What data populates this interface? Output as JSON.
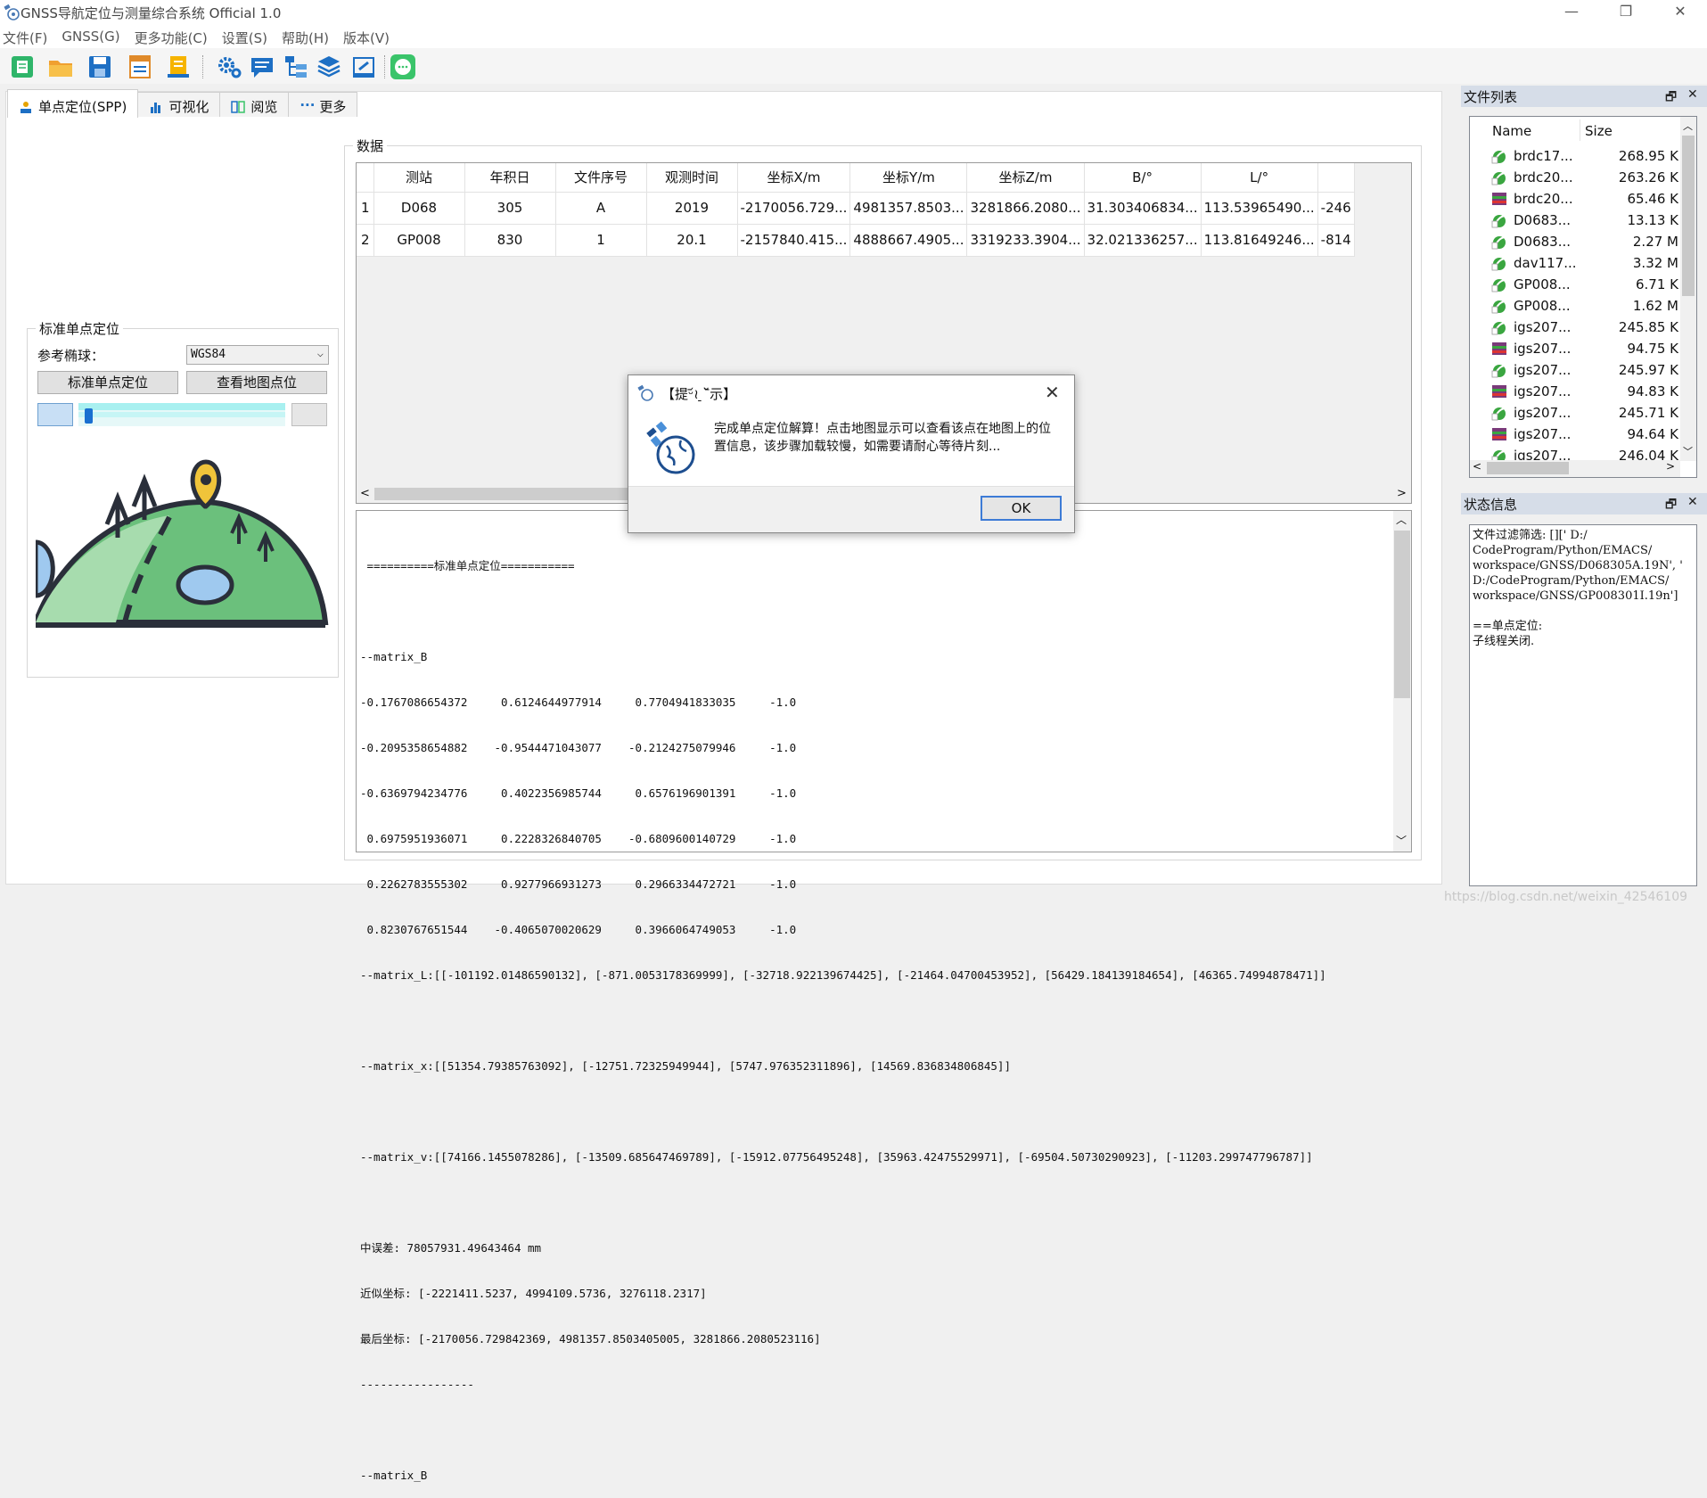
{
  "window": {
    "title": "GNSS导航定位与测量综合系统 Official 1.0",
    "minimize": "—",
    "maximize": "❐",
    "close": "✕"
  },
  "menu": [
    "文件(F)",
    "GNSS(G)",
    "更多功能(C)",
    "设置(S)",
    "帮助(H)",
    "版本(V)"
  ],
  "tabs": [
    {
      "label": "单点定位(SPP)",
      "icon": "person-pin-icon"
    },
    {
      "label": "可视化",
      "icon": "bar-chart-icon"
    },
    {
      "label": "阅览",
      "icon": "grid-view-icon"
    },
    {
      "label": "更多",
      "icon": "more-dots-icon"
    }
  ],
  "spp": {
    "group_title": "标准单点定位",
    "ellipsoid_label": "参考椭球：",
    "ellipsoid_value": "WGS84",
    "btn_position": "标准单点定位",
    "btn_map": "查看地图点位",
    "progress_percent": 2
  },
  "data": {
    "group_title": "数据",
    "columns": [
      "测站",
      "年积日",
      "文件序号",
      "观测时间",
      "坐标X/m",
      "坐标Y/m",
      "坐标Z/m",
      "B/°",
      "L/°",
      ""
    ],
    "rows": [
      [
        "1",
        "D068",
        "305",
        "A",
        "2019",
        "-2170056.729...",
        "4981357.8503...",
        "3281866.2080...",
        "31.303406834...",
        "113.53965490...",
        "-246"
      ],
      [
        "2",
        "GP008",
        "830",
        "1",
        "20.1",
        "-2157840.415...",
        "4888667.4905...",
        "3319233.3904...",
        "32.021336257...",
        "113.81649246...",
        "-814"
      ]
    ]
  },
  "log": {
    "lines": [
      " ==========标准单点定位===========",
      "",
      "--matrix_B",
      "-0.1767086654372     0.6124644977914     0.7704941833035     -1.0",
      "-0.2095358654882    -0.9544471043077    -0.2124275079946     -1.0",
      "-0.6369794234776     0.4022356985744     0.6576196901391     -1.0",
      " 0.6975951936071     0.2228326840705    -0.6809600140729     -1.0",
      " 0.2262783555302     0.9277966931273     0.2966334472721     -1.0",
      " 0.8230767651544    -0.4065070020629     0.3966064749053     -1.0",
      "--matrix_L:[[-101192.01486590132], [-871.0053178369999], [-32718.922139674425], [-21464.04700453952], [56429.184139184654], [46365.74994878471]]",
      "",
      "--matrix_x:[[51354.79385763092], [-12751.72325949944], [5747.976352311896], [14569.836834806845]]",
      "",
      "--matrix_v:[[74166.1455078286], [-13509.685647469789], [-15912.07756495248], [35963.42475529971], [-69504.50730290923], [-11203.299747796787]]",
      "",
      "中误差: 78057931.49643464 mm",
      "近似坐标: [-2221411.5237, 4994109.5736, 3276118.2317]",
      "最后坐标: [-2170056.729842369, 4981357.8503405005, 3281866.2080523116]",
      "-----------------",
      "",
      "--matrix_B"
    ]
  },
  "dialog": {
    "title": "【提ᵕ᷄≀ ̠˘᷅示】",
    "message": "完成单点定位解算！点击地图显示可以查看该点在地图上的位置信息，该步骤加载较慢，如需要请耐心等待片刻...",
    "ok": "OK",
    "close": "✕"
  },
  "file_list": {
    "title": "文件列表",
    "col_name": "Name",
    "col_size": "Size",
    "items": [
      {
        "name": "brdc17...",
        "size": "268.95 K",
        "icon": "green-file-icon"
      },
      {
        "name": "brdc20...",
        "size": "263.26 K",
        "icon": "green-file-icon"
      },
      {
        "name": "brdc20...",
        "size": "65.46 K",
        "icon": "archive-file-icon"
      },
      {
        "name": "D0683...",
        "size": "13.13 K",
        "icon": "green-file-icon"
      },
      {
        "name": "D0683...",
        "size": "2.27 M",
        "icon": "green-file-icon"
      },
      {
        "name": "dav117...",
        "size": "3.32 M",
        "icon": "green-file-icon"
      },
      {
        "name": "GP008...",
        "size": "6.71 K",
        "icon": "green-file-icon"
      },
      {
        "name": "GP008...",
        "size": "1.62 M",
        "icon": "green-file-icon"
      },
      {
        "name": "igs207...",
        "size": "245.85 K",
        "icon": "green-file-icon"
      },
      {
        "name": "igs207...",
        "size": "94.75 K",
        "icon": "archive-file-icon"
      },
      {
        "name": "igs207...",
        "size": "245.97 K",
        "icon": "green-file-icon"
      },
      {
        "name": "igs207...",
        "size": "94.83 K",
        "icon": "archive-file-icon"
      },
      {
        "name": "igs207...",
        "size": "245.71 K",
        "icon": "green-file-icon"
      },
      {
        "name": "igs207...",
        "size": "94.64 K",
        "icon": "archive-file-icon"
      },
      {
        "name": "igs207...",
        "size": "246.04 K",
        "icon": "green-file-icon"
      }
    ]
  },
  "status": {
    "title": "状态信息",
    "text": "文件过滤筛选: [][' D:/ CodeProgram/Python/EMACS/ workspace/GNSS/D068305A.19N', ' D:/CodeProgram/Python/EMACS/ workspace/GNSS/GP008301I.19n']\n\n==单点定位:\n子线程关闭."
  },
  "panel_buttons": {
    "float": "🗗",
    "close": "✕"
  },
  "watermark": "https://blog.csdn.net/weixin_42546109",
  "colors": {
    "accent": "#3d7bd6",
    "panel_header": "#d6dde8",
    "progress": "#a8f0f0"
  }
}
